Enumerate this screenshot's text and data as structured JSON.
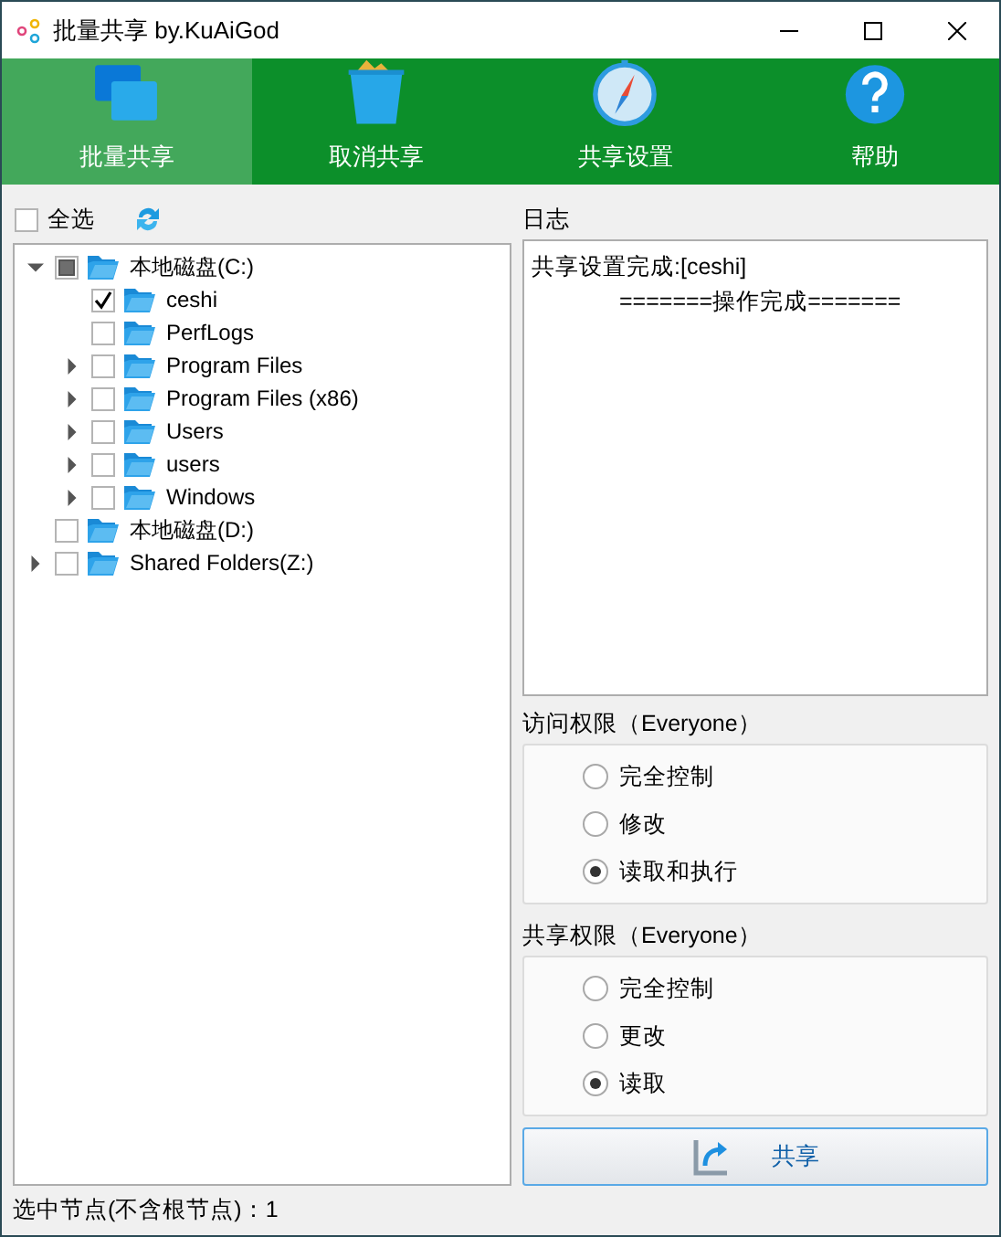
{
  "window": {
    "title": "批量共享 by.KuAiGod"
  },
  "toolbar": [
    {
      "label": "批量共享",
      "selected": true
    },
    {
      "label": "取消共享",
      "selected": false
    },
    {
      "label": "共享设置",
      "selected": false
    },
    {
      "label": "帮助",
      "selected": false
    }
  ],
  "select_all": {
    "label": "全选",
    "checked": false
  },
  "tree": [
    {
      "label": "本地磁盘(C:)",
      "checked": false,
      "partial": true,
      "expanded": true,
      "children": [
        {
          "label": "ceshi",
          "checked": true,
          "partial": false
        },
        {
          "label": "PerfLogs",
          "checked": false,
          "partial": false
        },
        {
          "label": "Program Files",
          "checked": false,
          "partial": false,
          "expanded": false
        },
        {
          "label": "Program Files (x86)",
          "checked": false,
          "partial": false,
          "expanded": false
        },
        {
          "label": "Users",
          "checked": false,
          "partial": false,
          "expanded": false
        },
        {
          "label": "users",
          "checked": false,
          "partial": false,
          "expanded": false
        },
        {
          "label": "Windows",
          "checked": false,
          "partial": false,
          "expanded": false
        }
      ]
    },
    {
      "label": "本地磁盘(D:)",
      "checked": false,
      "partial": false
    },
    {
      "label": "Shared Folders(Z:)",
      "checked": false,
      "partial": false,
      "expanded": false
    }
  ],
  "log": {
    "title": "日志",
    "lines": [
      "共享设置完成:[ceshi]",
      "=======操作完成======="
    ]
  },
  "groups": [
    {
      "title": "访问权限（Everyone）",
      "options": [
        {
          "label": "完全控制",
          "selected": false
        },
        {
          "label": "修改",
          "selected": false
        },
        {
          "label": "读取和执行",
          "selected": true
        }
      ]
    },
    {
      "title": "共享权限（Everyone）",
      "options": [
        {
          "label": "完全控制",
          "selected": false
        },
        {
          "label": "更改",
          "selected": false
        },
        {
          "label": "读取",
          "selected": true
        }
      ]
    }
  ],
  "share_button": {
    "label": "共享"
  },
  "status_bar": "选中节点(不含根节点)：1"
}
